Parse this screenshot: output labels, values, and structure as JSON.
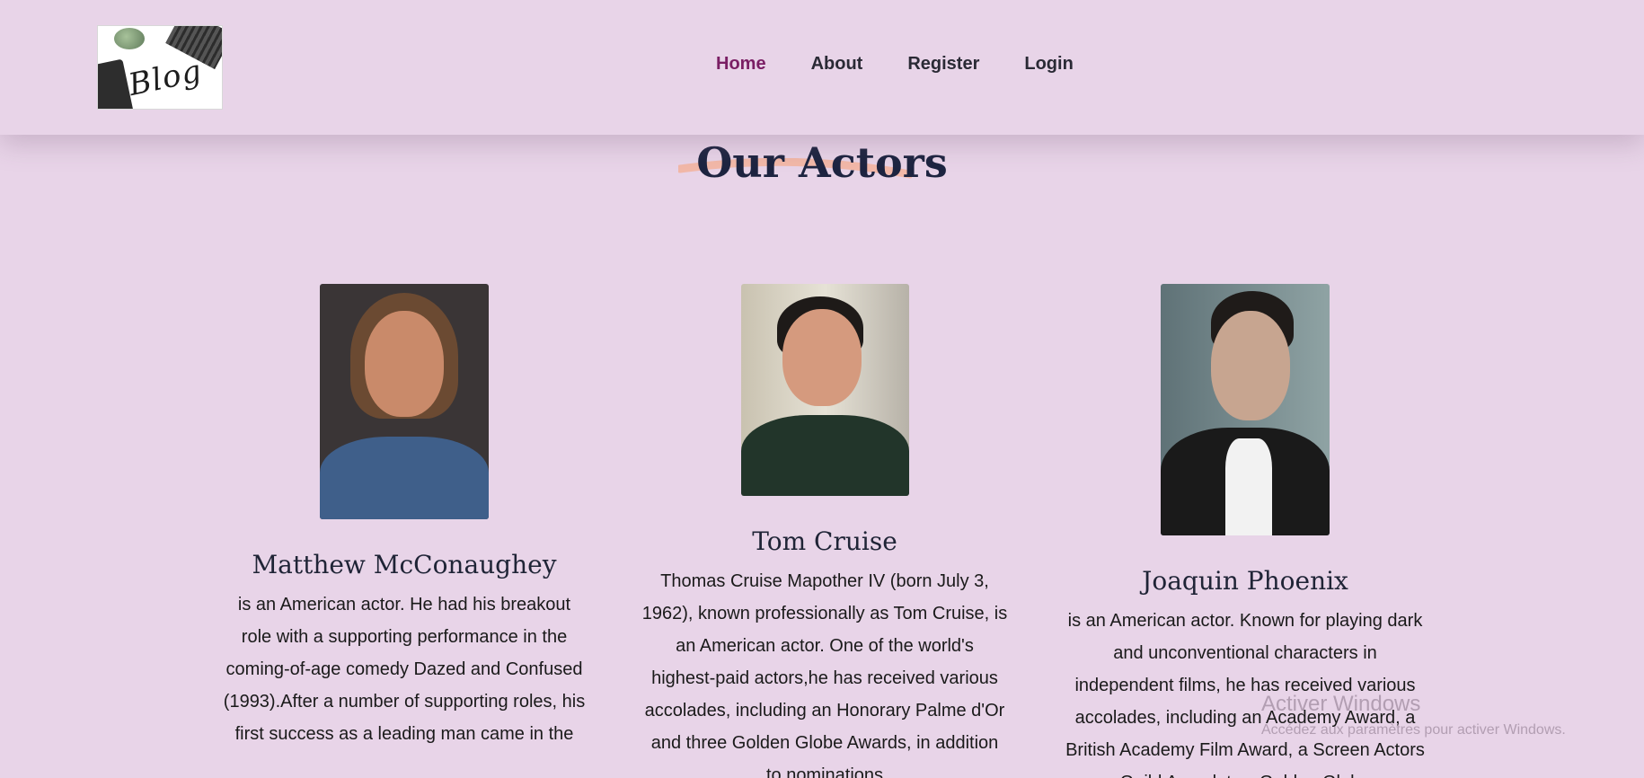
{
  "header": {
    "logo_text": "Blog",
    "nav": [
      {
        "label": "Home",
        "active": true
      },
      {
        "label": "About",
        "active": false
      },
      {
        "label": "Register",
        "active": false
      },
      {
        "label": "Login",
        "active": false
      }
    ]
  },
  "section": {
    "title": "Our Actors"
  },
  "actors": [
    {
      "name": "Matthew McConaughey",
      "bio": "is an American actor. He had his breakout role with a supporting performance in the coming-of-age comedy Dazed and Confused (1993).After a number of supporting roles, his first success as a leading man came in the"
    },
    {
      "name": "Tom Cruise",
      "bio": "Thomas Cruise Mapother IV (born July 3, 1962), known professionally as Tom Cruise, is an American actor. One of the world's highest-paid actors,he has received various accolades, including an Honorary Palme d'Or and three Golden Globe Awards, in addition to nominations"
    },
    {
      "name": "Joaquin Phoenix",
      "bio": "is an American actor. Known for playing dark and unconventional characters in independent films, he has received various accolades, including an Academy Award, a British Academy Film Award, a Screen Actors Guild Award, two Golden Globe"
    }
  ],
  "watermark": {
    "line1": "Activer Windows",
    "line2": "Accédez aux paramètres pour activer Windows."
  },
  "colors": {
    "page_bg": "#e8d4e8",
    "nav_active": "#7a1e64",
    "title": "#1d2440",
    "title_swash": "#f2b8a8"
  }
}
